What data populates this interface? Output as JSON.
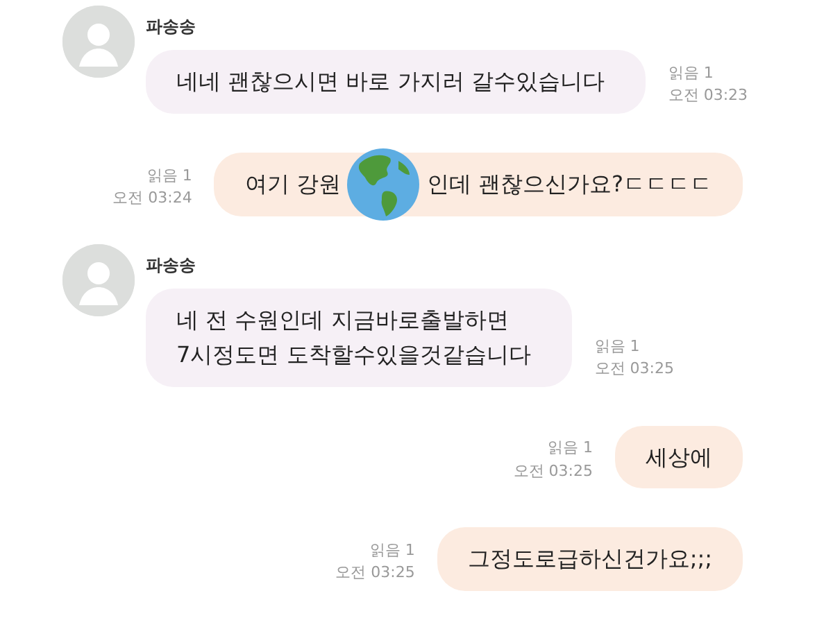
{
  "messages": [
    {
      "kind": "incoming",
      "sender": "파송송",
      "lines": [
        "네네  괜찮으시면 바로 가지러 갈수있습니다"
      ],
      "read": "읽음 1",
      "time": "오전 03:23"
    },
    {
      "kind": "outgoing",
      "segments": [
        {
          "kind": "text",
          "text": "여기 강원"
        },
        {
          "kind": "globe"
        },
        {
          "kind": "text",
          "text": "인데 괜찮으신가요?ㄷㄷㄷㄷ"
        }
      ],
      "read": "읽음 1",
      "time": "오전 03:24"
    },
    {
      "kind": "incoming",
      "sender": "파송송",
      "lines": [
        "네 전 수원인데 지금바로출발하면",
        "7시정도면 도착할수있을것같습니다"
      ],
      "read": "읽음 1",
      "time": "오전 03:25"
    },
    {
      "kind": "outgoing",
      "segments": [
        {
          "kind": "text",
          "text": "세상에"
        }
      ],
      "read": "읽음 1",
      "time": "오전 03:25"
    },
    {
      "kind": "outgoing",
      "segments": [
        {
          "kind": "text",
          "text": "그정도로급하신건가요;;;"
        }
      ],
      "read": "읽음 1",
      "time": "오전 03:25"
    }
  ]
}
